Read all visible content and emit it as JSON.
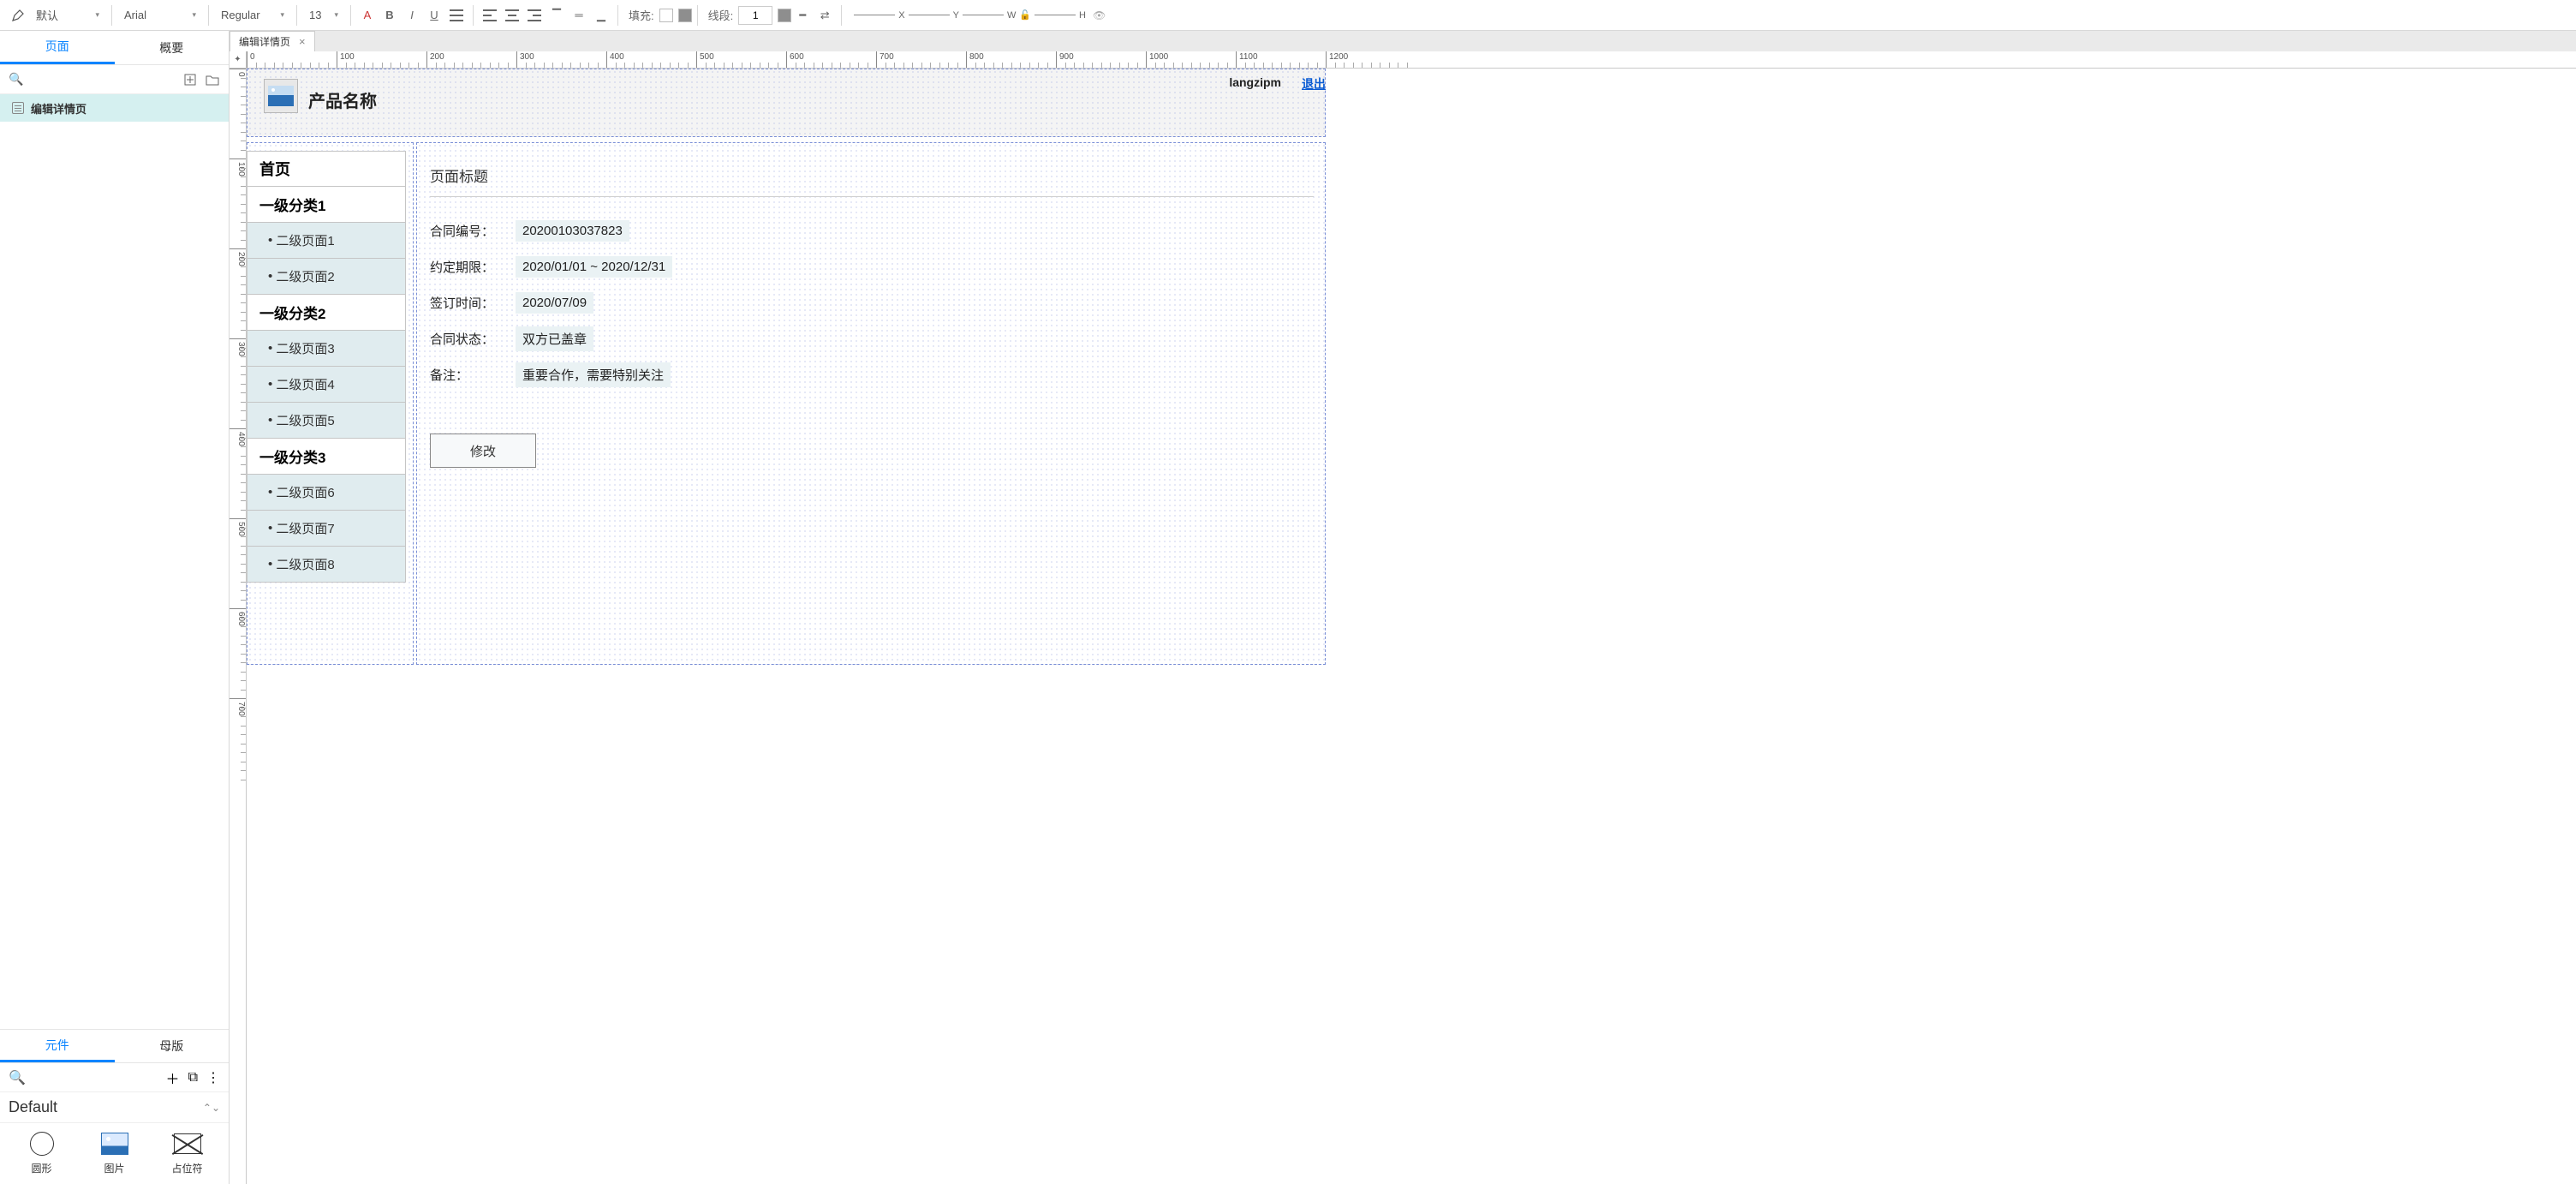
{
  "toolbar": {
    "style_preset": "默认",
    "font_family": "Arial",
    "font_weight": "Regular",
    "font_size": "13",
    "fill_label": "填充:",
    "stroke_label": "线段:",
    "stroke_width": "1",
    "x_label": "X",
    "y_label": "Y",
    "w_label": "W",
    "h_label": "H"
  },
  "left_panel": {
    "tab_pages": "页面",
    "tab_outline": "概要",
    "tree_item_1": "编辑详情页"
  },
  "components_panel": {
    "tab_widgets": "元件",
    "tab_masters": "母版",
    "library_name": "Default",
    "stencil_circle": "圆形",
    "stencil_image": "图片",
    "stencil_placeholder": "占位符"
  },
  "document_tab": {
    "title": "编辑详情页"
  },
  "ruler": {
    "h_majors": [
      0,
      100,
      200,
      300,
      400,
      500,
      600,
      700,
      800,
      900,
      1000,
      1100,
      1200
    ],
    "v_majors": [
      0,
      100,
      200,
      300,
      400,
      500,
      600,
      700
    ]
  },
  "mock": {
    "product_name": "产品名称",
    "username": "langzipm",
    "logout": "退出",
    "nav": {
      "home": "首页",
      "cat1": "一级分类1",
      "cat2": "一级分类2",
      "cat3": "一级分类3",
      "sub1": "二级页面1",
      "sub2": "二级页面2",
      "sub3": "二级页面3",
      "sub4": "二级页面4",
      "sub5": "二级页面5",
      "sub6": "二级页面6",
      "sub7": "二级页面7",
      "sub8": "二级页面8"
    },
    "page_title": "页面标题",
    "fields": {
      "contract_no_label": "合同编号：",
      "contract_no_value": "20200103037823",
      "period_label": "约定期限：",
      "period_value": "2020/01/01 ~ 2020/12/31",
      "signed_label": "签订时间：",
      "signed_value": "2020/07/09",
      "status_label": "合同状态：",
      "status_value": "双方已盖章",
      "remark_label": "备注：",
      "remark_value": "重要合作，需要特别关注"
    },
    "edit_button": "修改"
  }
}
